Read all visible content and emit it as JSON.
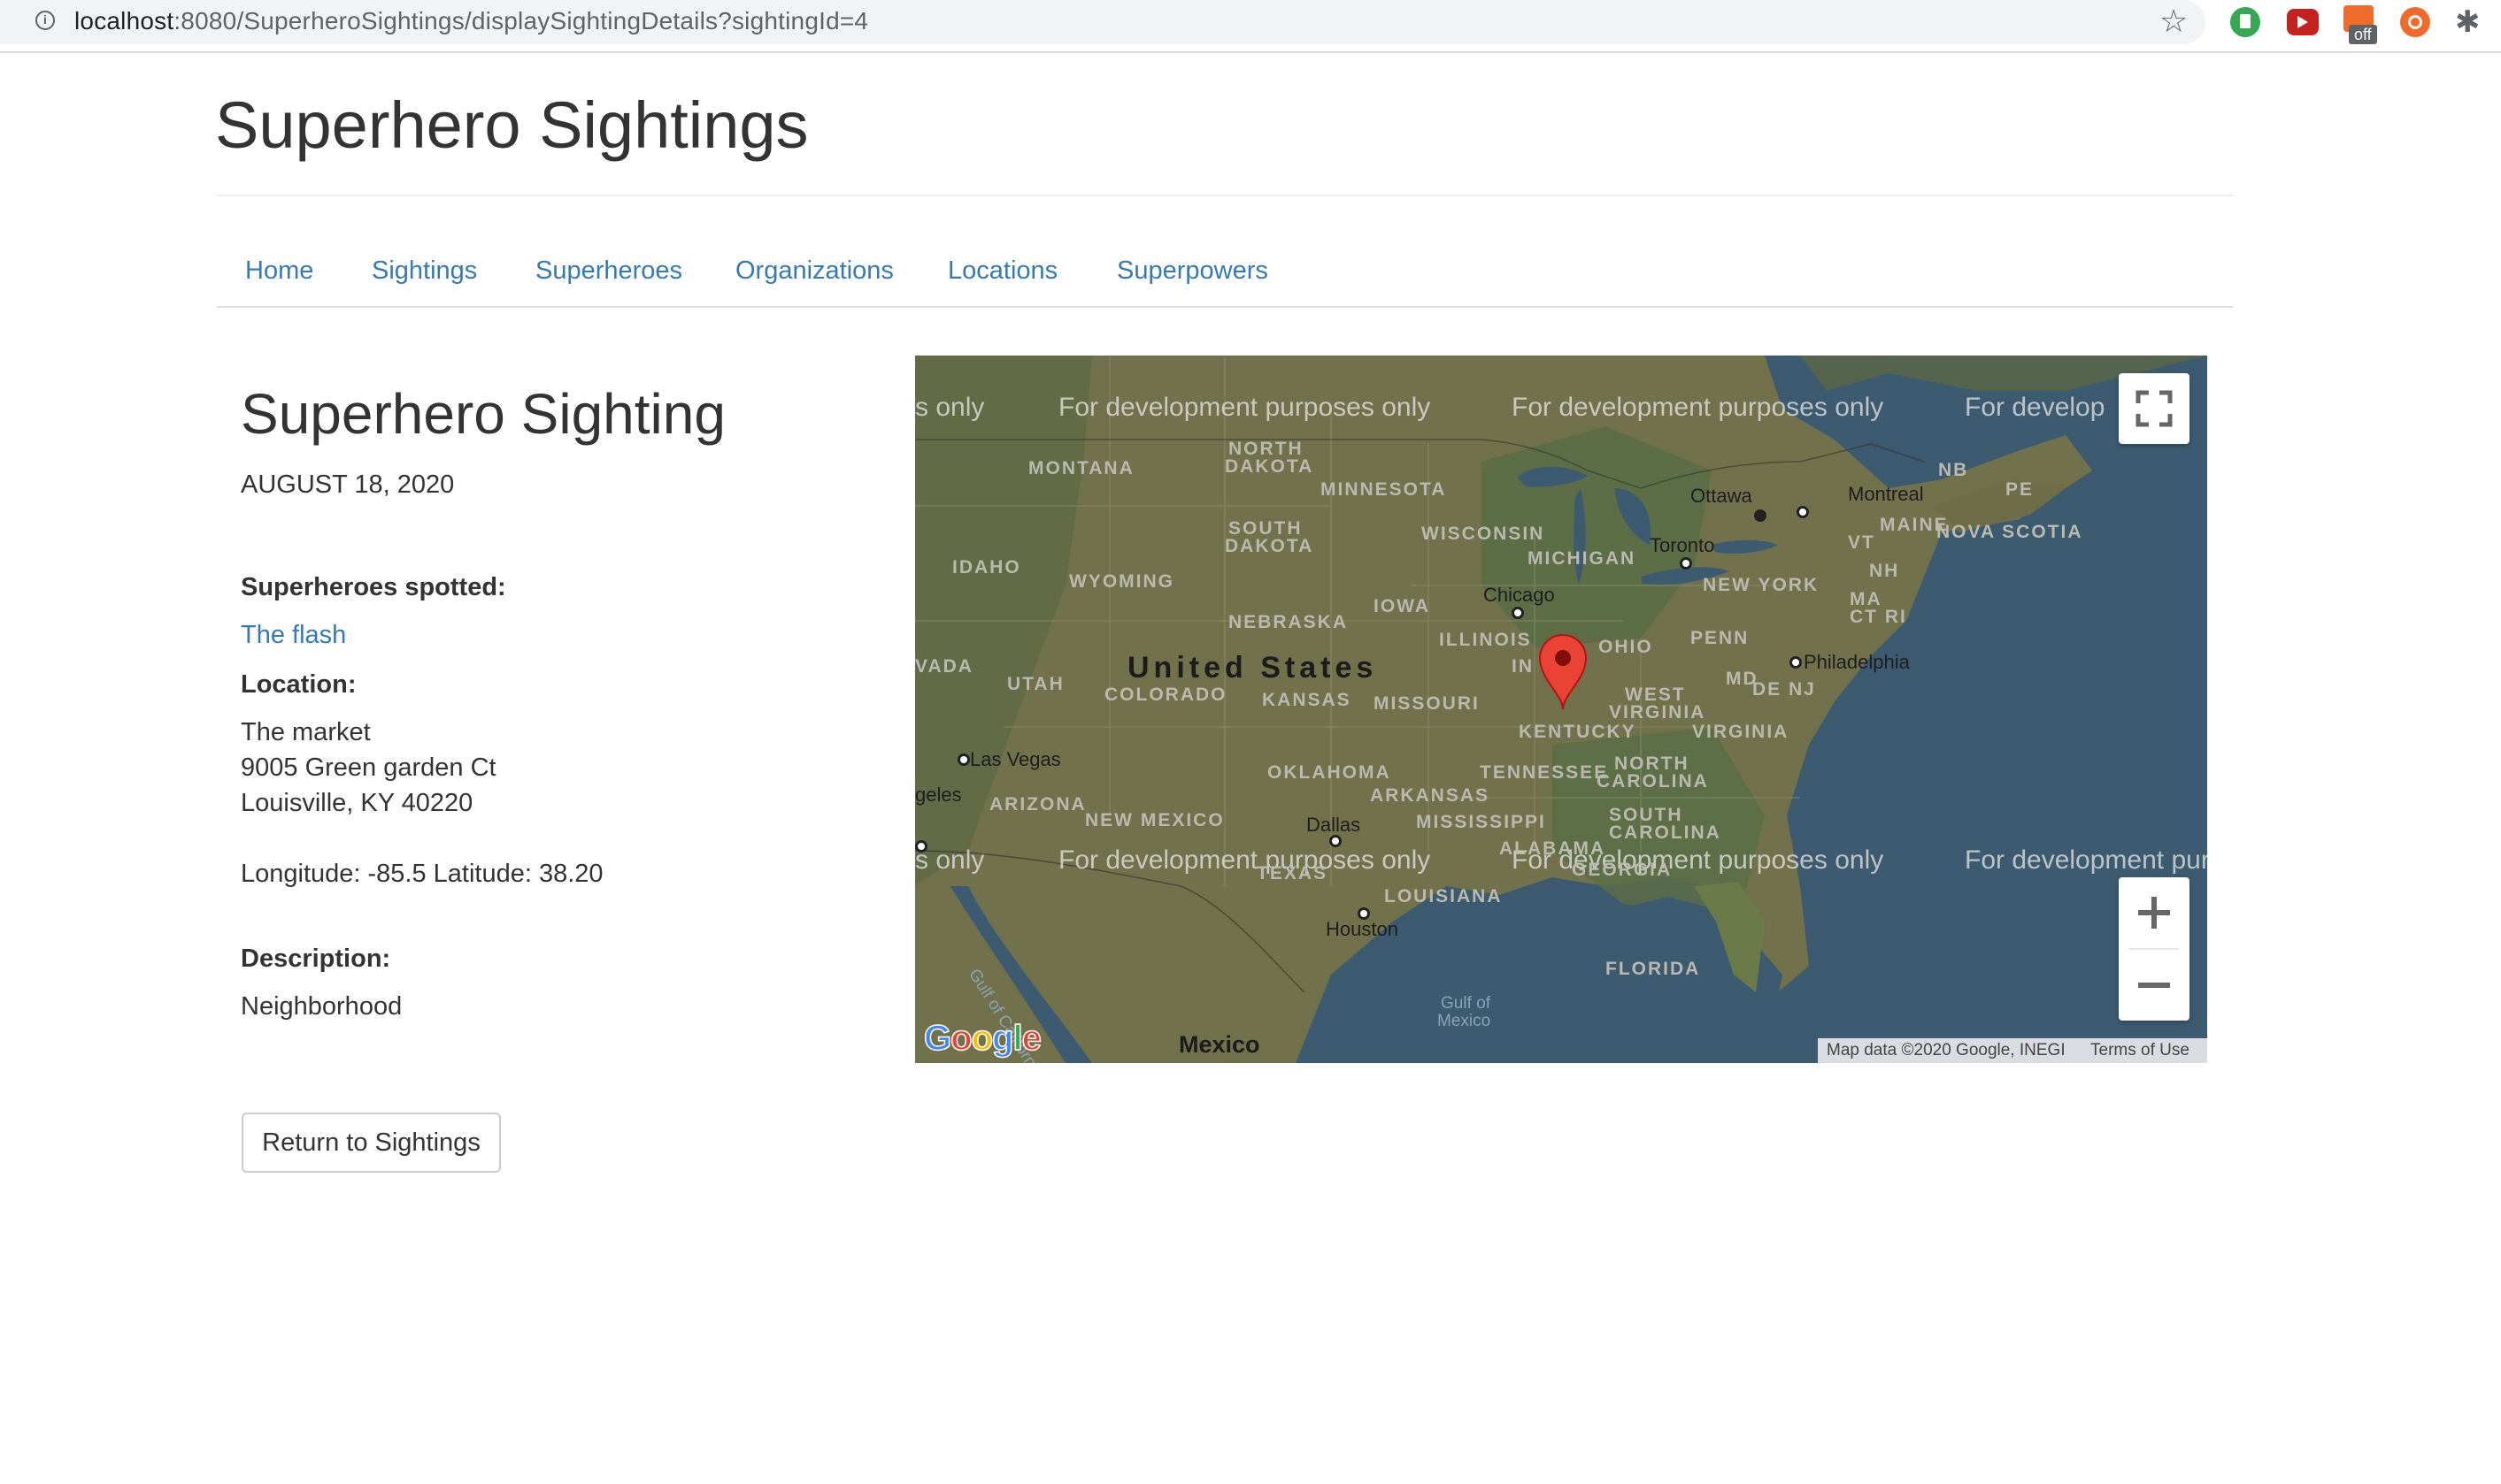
{
  "browser": {
    "url_host": "localhost",
    "url_path": ":8080/SuperheroSightings/displaySightingDetails?sightingId=4",
    "extension_badge": "off"
  },
  "site": {
    "title": "Superhero Sightings"
  },
  "nav": {
    "items": [
      {
        "label": "Home"
      },
      {
        "label": "Sightings"
      },
      {
        "label": "Superheroes"
      },
      {
        "label": "Organizations"
      },
      {
        "label": "Locations"
      },
      {
        "label": "Superpowers"
      }
    ]
  },
  "sighting": {
    "title": "Superhero Sighting",
    "date": "AUGUST 18, 2020",
    "superheroes_label": "Superheroes spotted:",
    "superheroes": [
      "The flash"
    ],
    "location_label": "Location:",
    "location_name": "The market",
    "street": "9005 Green garden Ct",
    "city_line": "Louisville, KY 40220",
    "coordinates": "Longitude: -85.5 Latitude: 38.20",
    "description_label": "Description:",
    "description": "Neighborhood",
    "return_button": "Return to Sightings"
  },
  "map": {
    "watermark": "For development purposes only",
    "attribution": "Map data ©2020 Google, INEGI",
    "terms": "Terms of Use",
    "logo": "Google",
    "icons": {
      "fullscreen": "fullscreen-icon",
      "zoom_in": "plus-icon",
      "zoom_out": "minus-icon",
      "marker": "map-pin-icon"
    },
    "labels": {
      "united_states": "United States",
      "mexico": "Mexico",
      "montana": "MONTANA",
      "north_dakota_1": "NORTH",
      "north_dakota_2": "DAKOTA",
      "south_dakota_1": "SOUTH",
      "south_dakota_2": "DAKOTA",
      "minnesota": "MINNESOTA",
      "wisconsin": "WISCONSIN",
      "michigan": "MICHIGAN",
      "idaho": "IDAHO",
      "wyoming": "WYOMING",
      "nebraska": "NEBRASKA",
      "iowa": "IOWA",
      "illinois": "ILLINOIS",
      "indiana": "IN",
      "ohio": "OHIO",
      "penn": "PENN",
      "new_york": "NEW YORK",
      "nevada": "VADA",
      "utah": "UTAH",
      "colorado": "COLORADO",
      "kansas": "KANSAS",
      "missouri": "MISSOURI",
      "kentucky": "KENTUCKY",
      "west_virginia_1": "WEST",
      "west_virginia_2": "VIRGINIA",
      "virginia": "VIRGINIA",
      "md": "MD",
      "de_nj": "DE NJ",
      "vt": "VT",
      "nh": "NH",
      "ma": "MA",
      "ct_ri": "CT RI",
      "maine": "MAINE",
      "nb": "NB",
      "pe": "PE",
      "nova_scotia": "NOVA SCOTIA",
      "arizona": "ARIZONA",
      "new_mexico": "NEW MEXICO",
      "oklahoma": "OKLAHOMA",
      "arkansas": "ARKANSAS",
      "tennessee": "TENNESSEE",
      "north_carolina_1": "NORTH",
      "north_carolina_2": "CAROLINA",
      "south_carolina_1": "SOUTH",
      "south_carolina_2": "CAROLINA",
      "mississippi": "MISSISSIPPI",
      "alabama": "ALABAMA",
      "georgia": "GEORGIA",
      "texas": "TEXAS",
      "louisiana": "LOUISIANA",
      "florida": "FLORIDA",
      "gulf_mexico_1": "Gulf of",
      "gulf_mexico_2": "Mexico",
      "gulf_california": "Gulf of California",
      "ottawa": "Ottawa",
      "montreal": "Montreal",
      "toronto": "Toronto",
      "chicago": "Chicago",
      "philadelphia": "Philadelphia",
      "las_vegas": "Las Vegas",
      "los_angeles": "geles",
      "dallas": "Dallas",
      "houston": "Houston",
      "partial_only": "s only",
      "partial_develop": "For develop",
      "partial_pur": "For development pur"
    }
  }
}
